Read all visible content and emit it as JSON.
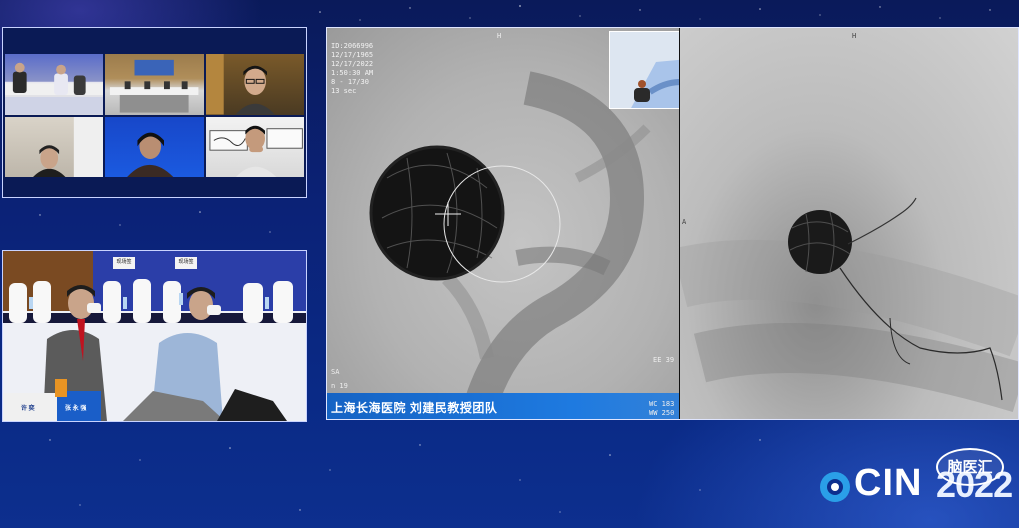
{
  "video_grid": {
    "tiles": [
      {
        "scene": "conference-room"
      },
      {
        "scene": "meeting-hall"
      },
      {
        "scene": "speaker-glasses"
      },
      {
        "scene": "office-participant"
      },
      {
        "scene": "blue-background-participant"
      },
      {
        "scene": "calligraphy-room-participant"
      }
    ]
  },
  "live_camera": {
    "backdrop_labels": [
      "现场签",
      "现场签"
    ],
    "table_sign_left": "许 奕",
    "table_sign_right": "张 永 强"
  },
  "angiography": {
    "left_overlay_lines": [
      "ID:2066996",
      "12/17/1965",
      "12/17/2022",
      "1:50:30 AM",
      "8 - 17/30",
      "13 sec"
    ],
    "left_top_marker": "H",
    "left_side_marker_bottom": "SA",
    "left_frame_number": "n 19",
    "left_ee_label": "EE 39",
    "left_wc": "WC 183",
    "left_ww": "WW 250",
    "right_top_marker": "H",
    "right_side_marker": "A",
    "caption": "上海长海医院 刘建民教授团队"
  },
  "logo": {
    "text": "CIN",
    "year": "2022",
    "badge": "脑医汇"
  },
  "colors": {
    "background": "#0b2277",
    "caption_bar": "#1a6fd6",
    "logo_accent": "#2a9fe8"
  }
}
